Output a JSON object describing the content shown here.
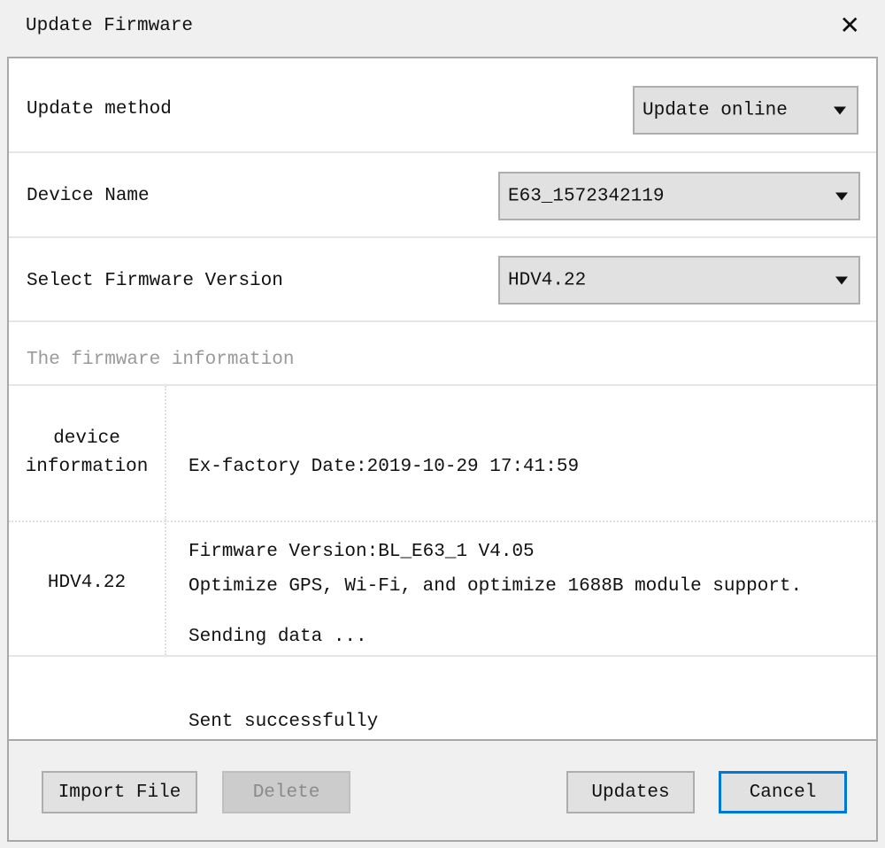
{
  "window": {
    "title": "Update Firmware",
    "close_icon": "close-x-icon"
  },
  "form": {
    "update_method": {
      "label": "Update method",
      "value": "Update online"
    },
    "device_name": {
      "label": "Device Name",
      "value": "E63_1572342119"
    },
    "firmware_version": {
      "label": "Select Firmware Version",
      "value": "HDV4.22"
    }
  },
  "firmware_info": {
    "header": "The firmware information",
    "rows": [
      {
        "label": "device\ninformation",
        "lines": [
          "Ex-factory Date:2019-10-29 17:41:59",
          "Firmware Version:BL_E63_1 V4.05",
          "Sending data ...",
          "Sent successfully"
        ]
      },
      {
        "label": "HDV4.22",
        "lines": [
          "Optimize GPS, Wi-Fi, and optimize 1688B module support."
        ]
      }
    ]
  },
  "buttons": {
    "import_file": "Import File",
    "delete": "Delete",
    "updates": "Updates",
    "cancel": "Cancel"
  },
  "colors": {
    "focus_accent": "#0078d7",
    "muted_text": "#999999"
  }
}
